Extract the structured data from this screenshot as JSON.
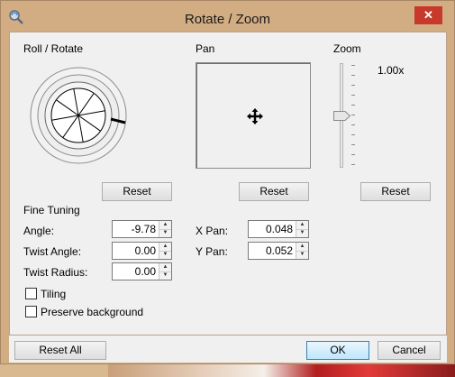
{
  "window": {
    "title": "Rotate / Zoom",
    "close_glyph": "✕"
  },
  "roll": {
    "label": "Roll / Rotate",
    "reset": "Reset"
  },
  "pan": {
    "label": "Pan",
    "reset": "Reset"
  },
  "zoom": {
    "label": "Zoom",
    "value": "1.00x",
    "reset": "Reset",
    "level": 0.0
  },
  "fine": {
    "label": "Fine Tuning",
    "angle": {
      "label": "Angle:",
      "value": "-9.78"
    },
    "twist_angle": {
      "label": "Twist Angle:",
      "value": "0.00"
    },
    "twist_radius": {
      "label": "Twist Radius:",
      "value": "0.00"
    },
    "x_pan": {
      "label": "X Pan:",
      "value": "0.048"
    },
    "y_pan": {
      "label": "Y Pan:",
      "value": "0.052"
    },
    "tiling": {
      "label": "Tiling",
      "checked": false
    },
    "preserve": {
      "label": "Preserve background",
      "checked": false
    }
  },
  "footer": {
    "reset_all": "Reset All",
    "ok": "OK",
    "cancel": "Cancel"
  },
  "icons": {
    "app": "rotate-zoom-app-icon",
    "move": "move-cursor-icon",
    "close": "close-icon"
  }
}
